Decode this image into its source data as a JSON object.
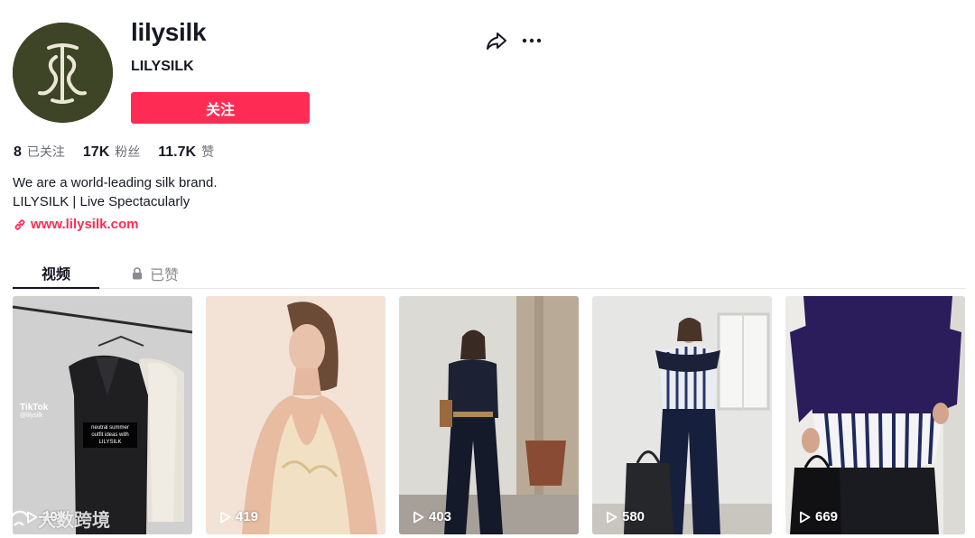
{
  "profile": {
    "username": "lilysilk",
    "nickname": "LILYSILK",
    "follow_label": "关注",
    "bio_line1": "We are a world-leading silk brand.",
    "bio_line2": "LILYSILK | Live Spectacularly",
    "link": "www.lilysilk.com"
  },
  "stats": [
    {
      "value": "8",
      "label": "已关注"
    },
    {
      "value": "17K",
      "label": "粉丝"
    },
    {
      "value": "11.7K",
      "label": "赞"
    }
  ],
  "tabs": {
    "videos": "视频",
    "liked": "已赞"
  },
  "videos": [
    {
      "views": "209",
      "badge": "TikTok",
      "badge_sub": "@lilysilk",
      "caption": "neutral summer outfit ideas with LILYSILK"
    },
    {
      "views": "419"
    },
    {
      "views": "403"
    },
    {
      "views": "580"
    },
    {
      "views": "669"
    }
  ],
  "watermark": "大数跨境",
  "colors": {
    "accent": "#fe2c55",
    "avatar_bg": "#3d4526",
    "text_primary": "#161823",
    "text_secondary": "#6b6d75"
  },
  "icons": [
    "share-icon",
    "more-icon",
    "link-icon",
    "lock-icon",
    "play-icon"
  ]
}
